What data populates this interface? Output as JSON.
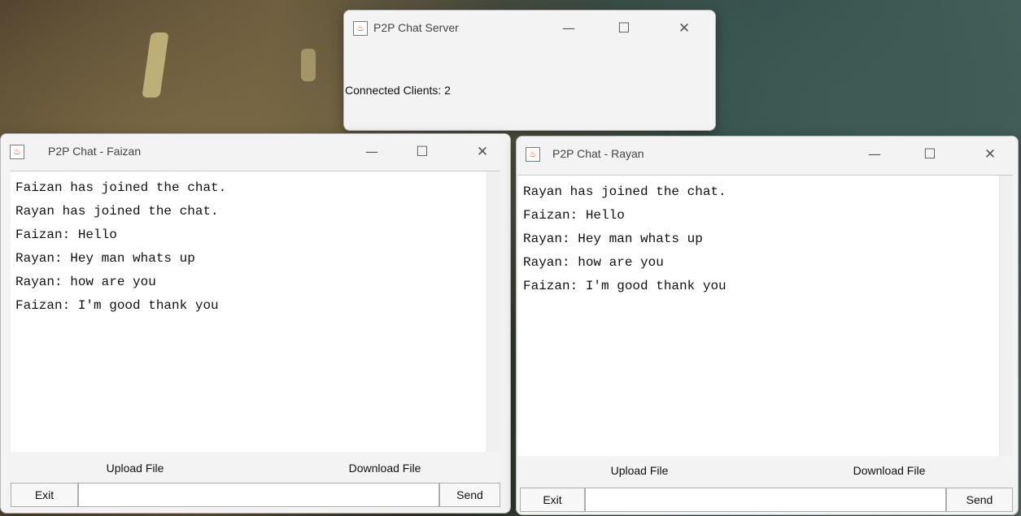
{
  "server_window": {
    "title": "P2P Chat Server",
    "status_text": "Connected Clients: 2"
  },
  "faizan_window": {
    "title": "P2P Chat - Faizan",
    "messages": [
      "Faizan has joined the chat.",
      "Rayan has joined the chat.",
      "Faizan: Hello",
      "Rayan: Hey man whats up",
      "Rayan: how are you",
      "Faizan: I'm good thank you"
    ],
    "upload_label": "Upload File",
    "download_label": "Download File",
    "exit_label": "Exit",
    "send_label": "Send",
    "input_value": ""
  },
  "rayan_window": {
    "title": "P2P Chat - Rayan",
    "messages": [
      "Rayan has joined the chat.",
      "Faizan: Hello",
      "Rayan: Hey man whats up",
      "Rayan: how are you",
      "Faizan: I'm good thank you"
    ],
    "upload_label": "Upload File",
    "download_label": "Download File",
    "exit_label": "Exit",
    "send_label": "Send",
    "input_value": ""
  },
  "window_controls": {
    "minimize": "—",
    "maximize": "☐",
    "close": "✕"
  },
  "icons": {
    "app": "java-app-icon"
  }
}
